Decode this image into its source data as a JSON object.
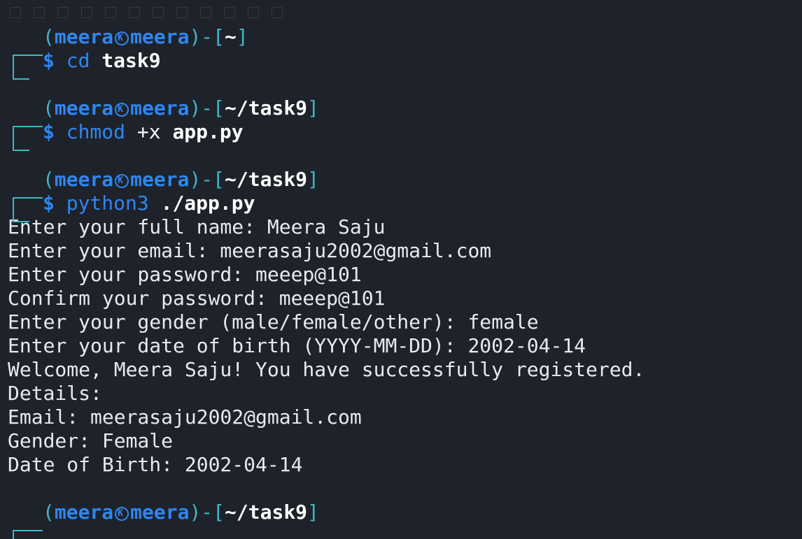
{
  "prompt": {
    "user": "meera",
    "host": "meera",
    "sep_open": "(",
    "sep_close": ")-[",
    "bracket_close": "]",
    "dollar": "$"
  },
  "blocks": [
    {
      "dir": "~",
      "cmd": "cd",
      "flag": "",
      "arg": "task9"
    },
    {
      "dir": "~/task9",
      "cmd": "chmod",
      "flag": "+x",
      "arg": "app.py"
    },
    {
      "dir": "~/task9",
      "cmd": "python3",
      "flag": "",
      "arg": "./app.py"
    }
  ],
  "output": [
    "Enter your full name: Meera Saju",
    "Enter your email: meerasaju2002@gmail.com",
    "Enter your password: meeep@101",
    "Confirm your password: meeep@101",
    "Enter your gender (male/female/other): female",
    "Enter your date of birth (YYYY-MM-DD): 2002-04-14",
    "Welcome, Meera Saju! You have successfully registered.",
    "Details:",
    "Email: meerasaju2002@gmail.com",
    "Gender: Female",
    "Date of Birth: 2002-04-14"
  ],
  "final_prompt": {
    "dir": "~/task9"
  },
  "colors": {
    "background": "#1e222a",
    "frame": "#3fb6c7",
    "user": "#2f86f0",
    "text": "#e8eaee"
  }
}
